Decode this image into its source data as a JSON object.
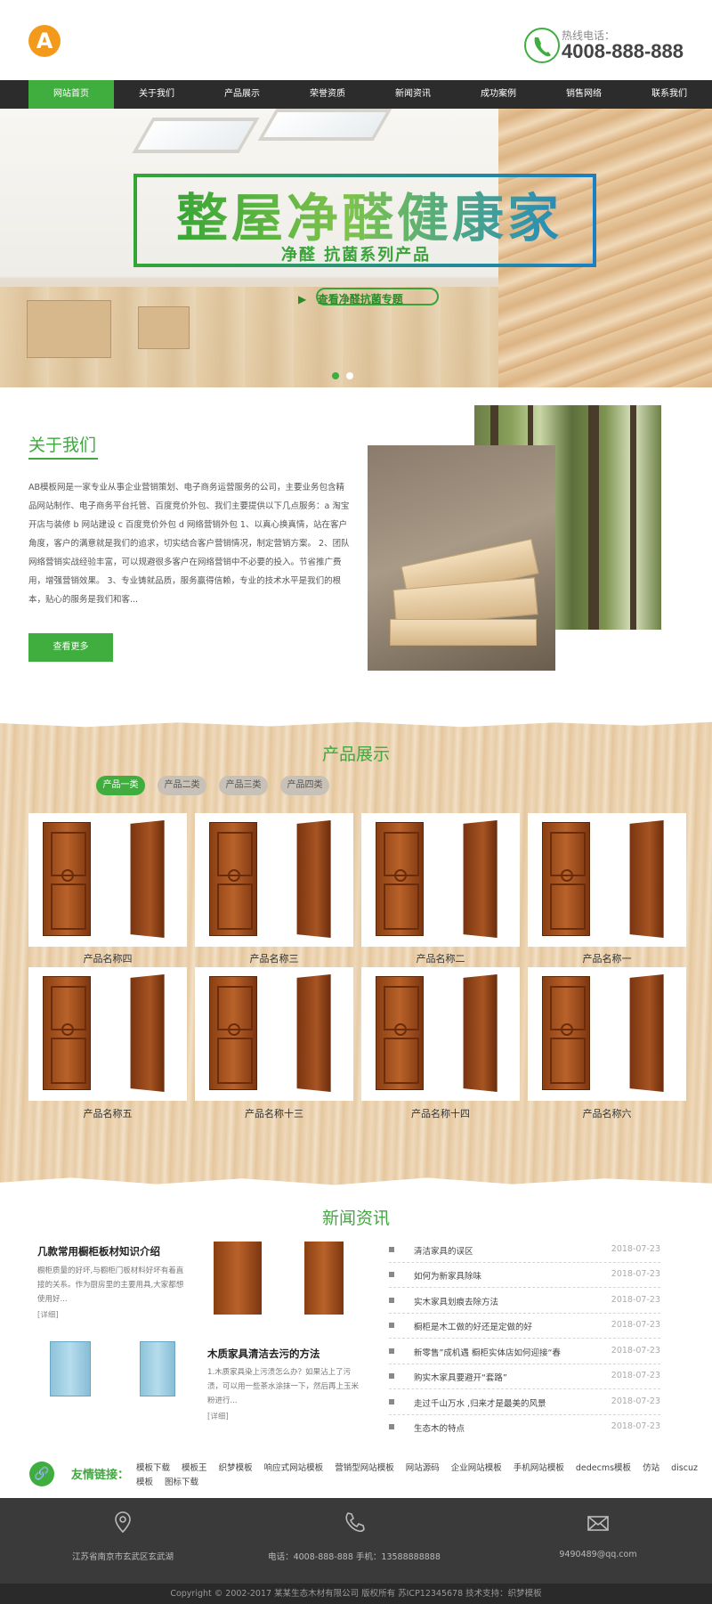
{
  "header": {
    "logo_letter": "A",
    "phone_label": "热线电话：",
    "phone_number": "4008-888-888"
  },
  "nav": {
    "items": [
      "网站首页",
      "关于我们",
      "产品展示",
      "荣誉资质",
      "新闻资讯",
      "成功案例",
      "销售网络",
      "联系我们"
    ],
    "active_index": 0
  },
  "banner": {
    "title": "整屋净醛健康家",
    "subtitle": "净醛  抗菌系列产品",
    "cta": "查看净醛抗菌专题",
    "slides": 2,
    "active_slide": 0
  },
  "about": {
    "title": "关于我们",
    "text": "AB模板网是一家专业从事企业营销策划、电子商务运营服务的公司，主要业务包含精品网站制作、电子商务平台托管、百度竞价外包、我们主要提供以下几点服务：a 淘宝开店与装修 b 网站建设 c 百度竞价外包 d 网络营销外包 1、以真心换真情，站在客户角度，客户的满意就是我们的追求，切实结合客户营销情况，制定营销方案。 2、团队网络营销实战经验丰富，可以规避很多客户在网络营销中不必要的投入。节省推广费用，增强营销效果。 3、专业铸就品质，服务赢得信赖，专业的技术水平是我们的根本，贴心的服务是我们和客...",
    "more": "查看更多"
  },
  "products": {
    "title": "产品展示",
    "tabs": [
      "产品一类",
      "产品二类",
      "产品三类",
      "产品四类"
    ],
    "active_tab": 0,
    "items": [
      "产品名称四",
      "产品名称三",
      "产品名称二",
      "产品名称一",
      "产品名称五",
      "产品名称十三",
      "产品名称十四",
      "产品名称六"
    ]
  },
  "news": {
    "title": "新闻资讯",
    "features": [
      {
        "title": "几款常用橱柜板材知识介绍",
        "text": "橱柜质量的好坏,与橱柜门板材料好坏有着直接的关系。作为厨房里的主要用具,大家都想使用好...",
        "link": "[详细]"
      },
      {
        "title": "木质家具清洁去污的方法",
        "text": "1.木质家具染上污渍怎么办？如果沾上了污渍，可以用一些茶水涂抹一下，然后再上玉米粉进行...",
        "link": "[详细]"
      }
    ],
    "items": [
      {
        "text": "清洁家具的误区",
        "date": "2018-07-23"
      },
      {
        "text": "如何为新家具除味",
        "date": "2018-07-23"
      },
      {
        "text": "实木家具划痕去除方法",
        "date": "2018-07-23"
      },
      {
        "text": "橱柜是木工做的好还是定做的好",
        "date": "2018-07-23"
      },
      {
        "text": "新零售”成机遇 橱柜实体店如何迎接“春",
        "date": "2018-07-23"
      },
      {
        "text": "购实木家具要避开“套路”",
        "date": "2018-07-23"
      },
      {
        "text": "走过千山万水 ,归来才是最美的风景",
        "date": "2018-07-23"
      },
      {
        "text": "生态木的特点",
        "date": "2018-07-23"
      }
    ]
  },
  "links": {
    "label": "友情链接：",
    "items": [
      "模板下载",
      "模板王",
      "织梦模板",
      "响应式网站模板",
      "营销型网站模板",
      "网站源码",
      "企业网站模板",
      "手机网站模板",
      "dedecms模板",
      "仿站",
      "discuz模板",
      "图标下载"
    ]
  },
  "footer": {
    "address": "江苏省南京市玄武区玄武湖",
    "phone": "电话：4008-888-888 手机：13588888888",
    "email": "9490489@qq.com",
    "copyright": "Copyright © 2002-2017 某某生态木材有限公司 版权所有    苏ICP12345678    技术支持：织梦模板"
  },
  "colors": {
    "accent": "#3fae3f",
    "nav_bg": "#2c2c2c",
    "footer_bg": "#3a3a3a",
    "logo": "#f39a1d"
  },
  "icons": [
    "phone-icon",
    "location-icon",
    "telephone-icon",
    "mail-icon",
    "link-icon",
    "logo-icon"
  ]
}
